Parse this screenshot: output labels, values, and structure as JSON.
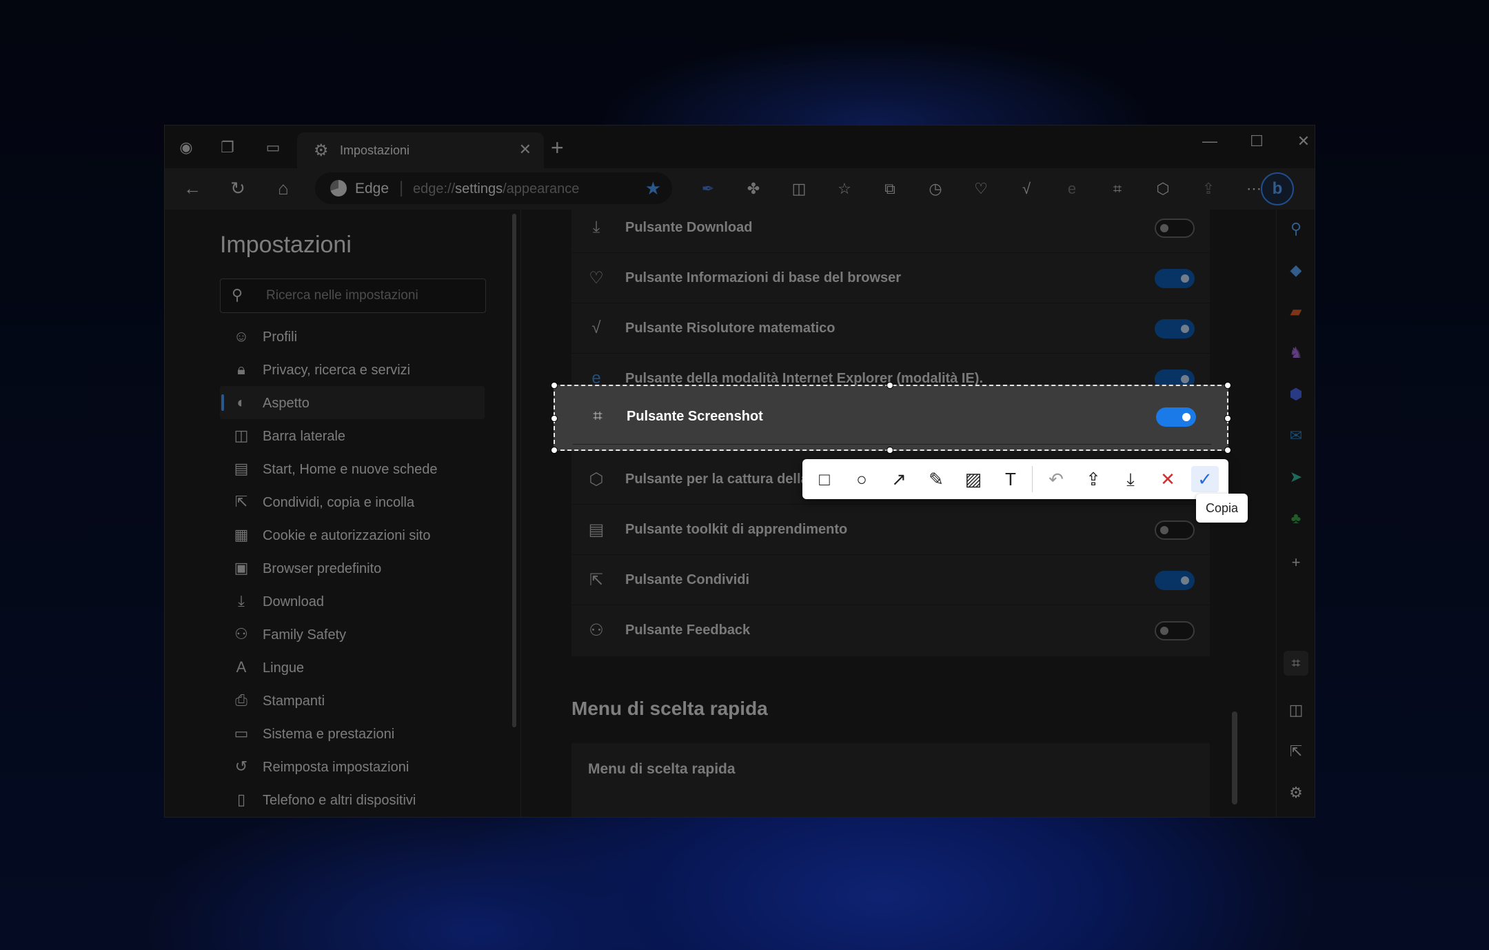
{
  "browser": {
    "tab_title": "Impostazioni",
    "site_label": "Edge",
    "url_prefix": "edge://",
    "url_host": "settings",
    "url_path": "/appearance"
  },
  "sidebar": {
    "title": "Impostazioni",
    "search_placeholder": "Ricerca nelle impostazioni",
    "items": [
      {
        "label": "Profili",
        "icon": "profile-icon"
      },
      {
        "label": "Privacy, ricerca e servizi",
        "icon": "lock-icon"
      },
      {
        "label": "Aspetto",
        "icon": "palette-icon"
      },
      {
        "label": "Barra laterale",
        "icon": "sidebar-icon"
      },
      {
        "label": "Start, Home e nuove schede",
        "icon": "home-tab-icon"
      },
      {
        "label": "Condividi, copia e incolla",
        "icon": "share-icon"
      },
      {
        "label": "Cookie e autorizzazioni sito",
        "icon": "cookie-icon"
      },
      {
        "label": "Browser predefinito",
        "icon": "browser-icon"
      },
      {
        "label": "Download",
        "icon": "download-icon"
      },
      {
        "label": "Family Safety",
        "icon": "family-icon"
      },
      {
        "label": "Lingue",
        "icon": "language-icon"
      },
      {
        "label": "Stampanti",
        "icon": "printer-icon"
      },
      {
        "label": "Sistema e prestazioni",
        "icon": "laptop-icon"
      },
      {
        "label": "Reimposta impostazioni",
        "icon": "reset-icon"
      },
      {
        "label": "Telefono e altri dispositivi",
        "icon": "phone-icon"
      }
    ]
  },
  "toolbar_buttons": {
    "rows": [
      {
        "label": "Pulsante Download",
        "on": false
      },
      {
        "label": "Pulsante Informazioni di base del browser",
        "on": true
      },
      {
        "label": "Pulsante Risolutore matematico",
        "on": true
      },
      {
        "label": "Pulsante della modalità Internet Explorer (modalità IE).",
        "on": true
      },
      {
        "label": "Pulsante Screenshot",
        "on": true
      },
      {
        "label": "Pulsante per la cattura della",
        "on": true
      },
      {
        "label": "Pulsante toolkit di apprendimento",
        "on": false
      },
      {
        "label": "Pulsante Condividi",
        "on": true
      },
      {
        "label": "Pulsante Feedback",
        "on": false
      }
    ]
  },
  "context_menu": {
    "section_title": "Menu di scelta rapida",
    "card_label": "Menu di scelta rapida"
  },
  "annotation": {
    "tooltip": "Copia"
  },
  "colors": {
    "accent": "#1a7ae8",
    "toggle_on": "#0f5fb8",
    "background": "#202020"
  }
}
